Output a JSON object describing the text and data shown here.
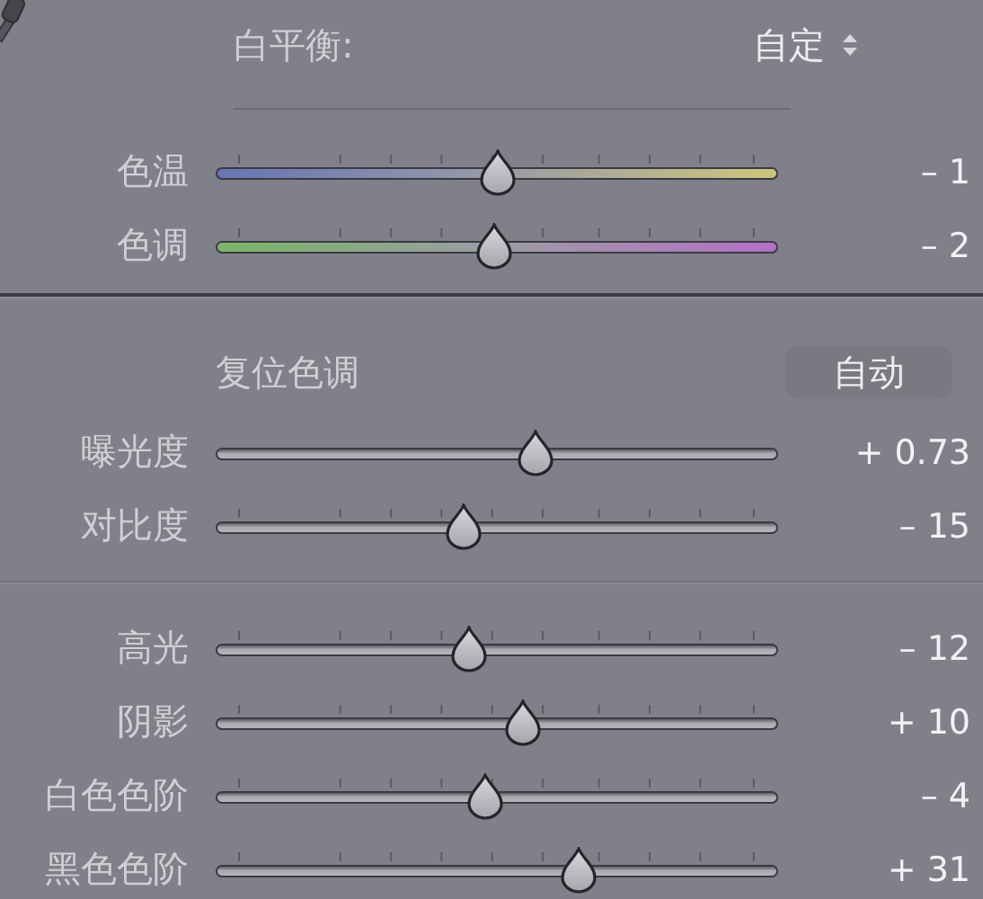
{
  "white_balance": {
    "label": "白平衡:",
    "value": "自定"
  },
  "wb_sliders": [
    {
      "label": "色温",
      "kind": "temperature",
      "level": 0.5,
      "ticks": true,
      "reading": "– 1"
    },
    {
      "label": "色调",
      "kind": "tint",
      "level": 0.495,
      "ticks": true,
      "reading": "– 2"
    }
  ],
  "tone": {
    "label": "复位色调",
    "auto_button": "自动"
  },
  "tone_sliders": [
    {
      "label": "曝光度",
      "kind": "plain",
      "level": 0.57,
      "ticks": false,
      "reading": "+ 0.73"
    },
    {
      "label": "对比度",
      "kind": "plain",
      "level": 0.44,
      "ticks": true,
      "reading": "– 15"
    }
  ],
  "presence_sliders": [
    {
      "label": "高光",
      "kind": "plain",
      "level": 0.45,
      "ticks": true,
      "reading": "– 12"
    },
    {
      "label": "阴影",
      "kind": "plain",
      "level": 0.546,
      "ticks": true,
      "reading": "+ 10"
    },
    {
      "label": "白色色阶",
      "kind": "plain",
      "level": 0.48,
      "ticks": true,
      "reading": "– 4"
    },
    {
      "label": "黑色色阶",
      "kind": "plain",
      "level": 0.645,
      "ticks": true,
      "reading": "+ 31"
    }
  ]
}
